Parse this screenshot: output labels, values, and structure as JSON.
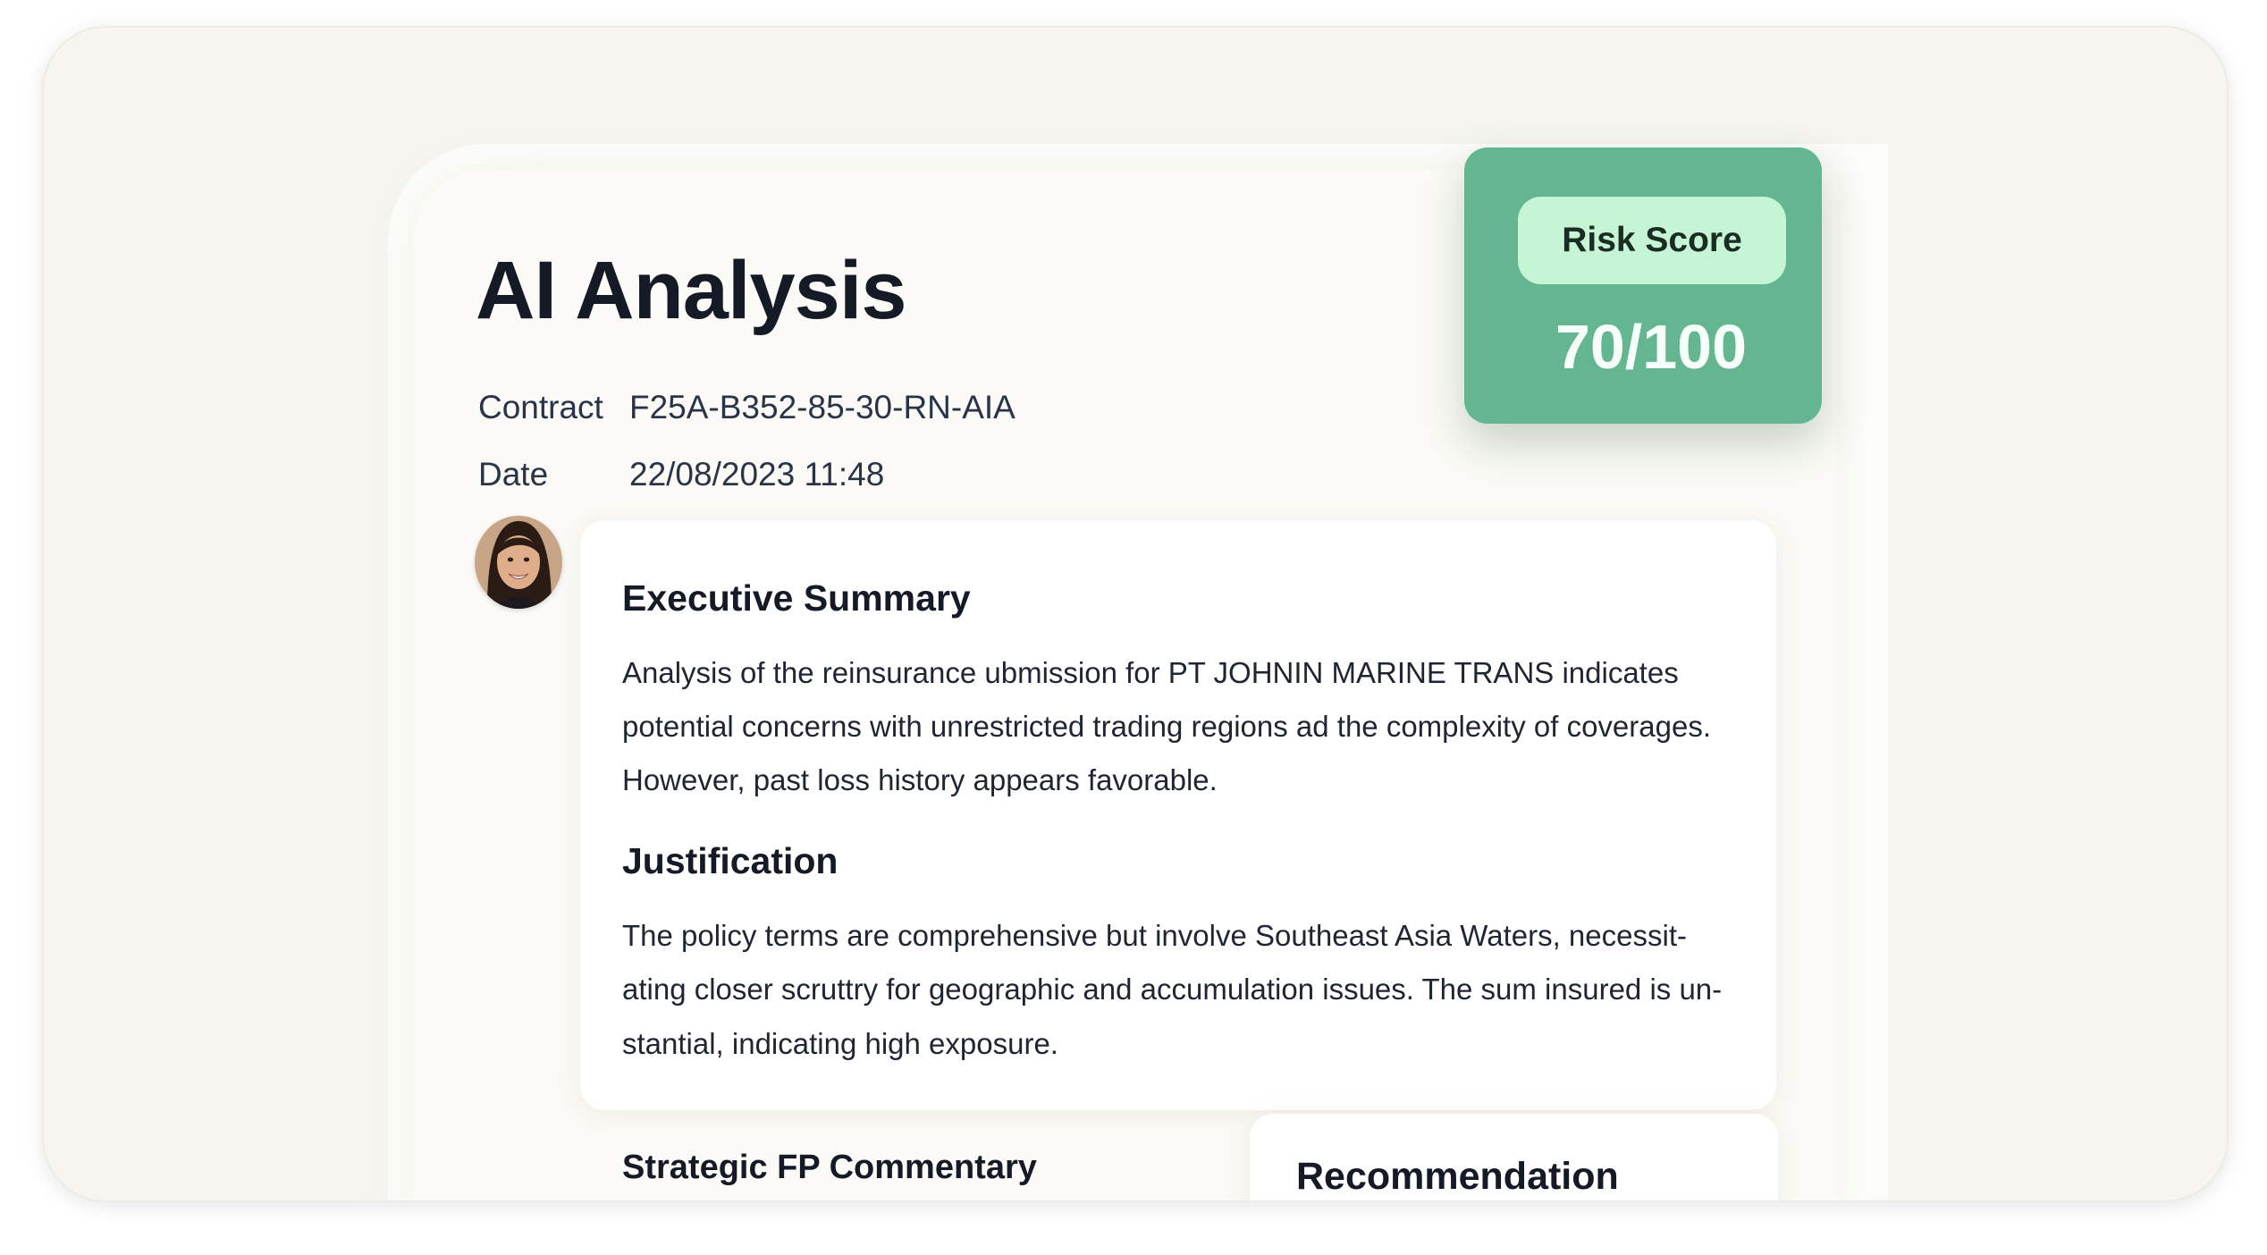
{
  "page": {
    "title": "AI Analysis"
  },
  "meta": {
    "contract_label": "Contract",
    "contract_value": "F25A-B352-85-30-RN-AIA",
    "date_label": "Date",
    "date_value": "22/08/2023 11:48"
  },
  "risk": {
    "label": "Risk Score",
    "value": "70/100",
    "score": 70,
    "max": 100,
    "color": "#63b690"
  },
  "executive_summary": {
    "heading": "Executive Summary",
    "lines": [
      "Analysis of the reinsurance ubmission for PT JOHNIN MARINE  TRANS indicates",
      "potential concerns with unrestricted trading regions ad the complexity of coverages.",
      "However, past loss history appears favorable."
    ]
  },
  "justification": {
    "heading": "Justification",
    "lines": [
      "The policy terms are comprehensive but involve Southeast Asia Waters, necessit-",
      "ating closer scruttry for geographic and accumulation issues. The sum insured is un-",
      "stantial, indicating high exposure."
    ]
  },
  "strategic": {
    "heading": "Strategic FP Commentary"
  },
  "recommendation": {
    "heading": "Recommendation"
  },
  "avatar": {
    "icon": "user-avatar-photo"
  }
}
